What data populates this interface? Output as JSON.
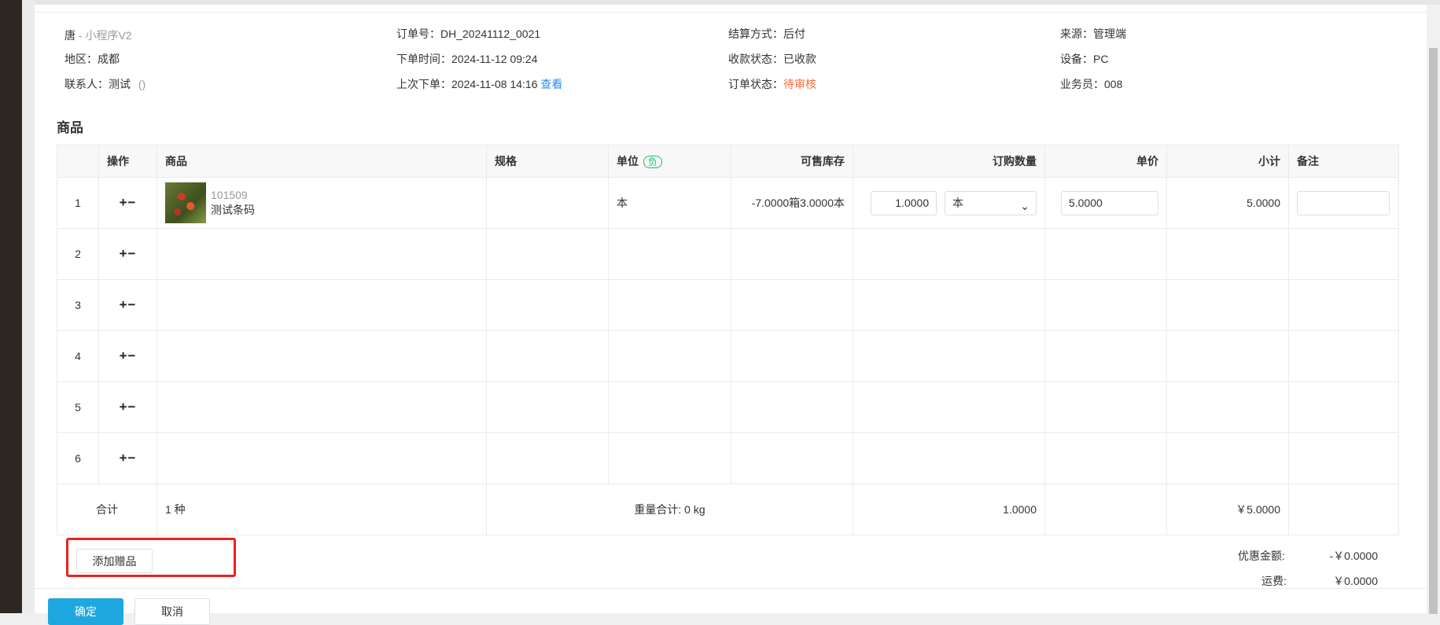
{
  "info": {
    "customer_name": "唐",
    "customer_suffix": " - 小程序V2",
    "region_label": "地区：",
    "region": "成都",
    "contact_label": "联系人：",
    "contact": "测试",
    "contact_phone": "()",
    "order_no_label": "订单号：",
    "order_no": "DH_20241112_0021",
    "order_time_label": "下单时间：",
    "order_time": "2024-11-12 09:24",
    "last_order_label": "上次下单：",
    "last_order": "2024-11-08 14:16",
    "view_link": "查看",
    "settle_label": "结算方式：",
    "settle": "后付",
    "payment_status_label": "收款状态：",
    "payment_status": "已收款",
    "order_status_label": "订单状态：",
    "order_status": "待审核",
    "source_label": "来源：",
    "source": "管理端",
    "device_label": "设备：",
    "device": "PC",
    "salesman_label": "业务员：",
    "salesman": "008"
  },
  "section_title": "商品",
  "table": {
    "headers": {
      "op": "操作",
      "product": "商品",
      "spec": "规格",
      "unit": "单位",
      "unit_badge": "负",
      "stock": "可售库存",
      "qty": "订购数量",
      "price": "单价",
      "subtotal": "小计",
      "remark": "备注"
    },
    "plus_minus": "+−",
    "rows": [
      {
        "no": "1",
        "code": "101509",
        "name": "测试条码",
        "spec": "",
        "unit": "本",
        "stock": "-7.0000箱3.0000本",
        "qty": "1.0000",
        "qty_unit": "本",
        "price": "5.0000",
        "subtotal": "5.0000",
        "remark": ""
      },
      {
        "no": "2"
      },
      {
        "no": "3"
      },
      {
        "no": "4"
      },
      {
        "no": "5"
      },
      {
        "no": "6"
      }
    ],
    "total": {
      "label": "合计",
      "kinds": "1 种",
      "weight": "重量合计: 0 kg",
      "qty": "1.0000",
      "amount": "￥5.0000"
    }
  },
  "gift_button": "添加赠品",
  "summary": {
    "discount_label": "优惠金额:",
    "discount": "-￥0.0000",
    "freight_label": "运费:",
    "freight": "￥0.0000"
  },
  "footer": {
    "confirm": "确定",
    "cancel": "取消"
  },
  "colors": {
    "link": "#2d8cf0",
    "warn": "#ff6a3c",
    "badge": "#19be6b",
    "primary": "#1fa8e0",
    "highlight": "#e8231f"
  }
}
